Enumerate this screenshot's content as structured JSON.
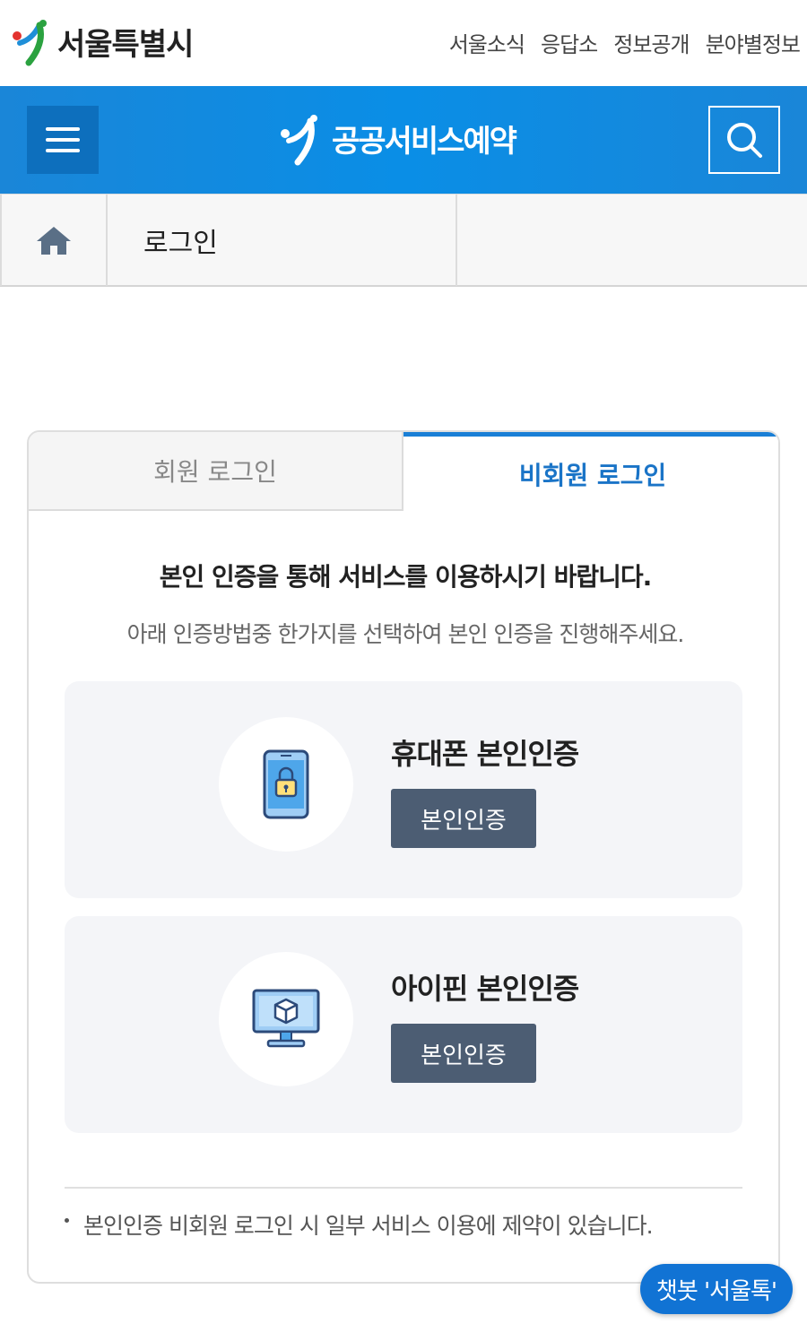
{
  "top": {
    "logo_text": "서울특별시",
    "links": [
      "서울소식",
      "응답소",
      "정보공개",
      "분야별정보"
    ]
  },
  "header": {
    "title": "공공서비스예약",
    "colors": {
      "header_blue": "#0a8ee6",
      "menu_dark_blue": "#0d6fbd"
    },
    "menu_icon": "hamburger-icon",
    "search_icon": "search-icon"
  },
  "breadcrumb": {
    "home_icon": "home-icon",
    "current": "로그인"
  },
  "login": {
    "tabs": {
      "member": "회원 로그인",
      "guest": "비회원 로그인"
    },
    "message_main": "본인 인증을 통해 서비스를 이용하시기 바랍니다.",
    "message_sub": "아래 인증방법중 한가지를 선택하여 본인 인증을 진행해주세요.",
    "methods": {
      "phone": {
        "title": "휴대폰 본인인증",
        "button": "본인인증",
        "icon": "smartphone-lock-icon"
      },
      "ipin": {
        "title": "아이핀 본인인증",
        "button": "본인인증",
        "icon": "monitor-cube-icon"
      }
    },
    "notice": "본인인증 비회원 로그인 시 일부 서비스 이용에 제약이 있습니다."
  },
  "chatbot": {
    "label": "챗봇 '서울톡'"
  }
}
